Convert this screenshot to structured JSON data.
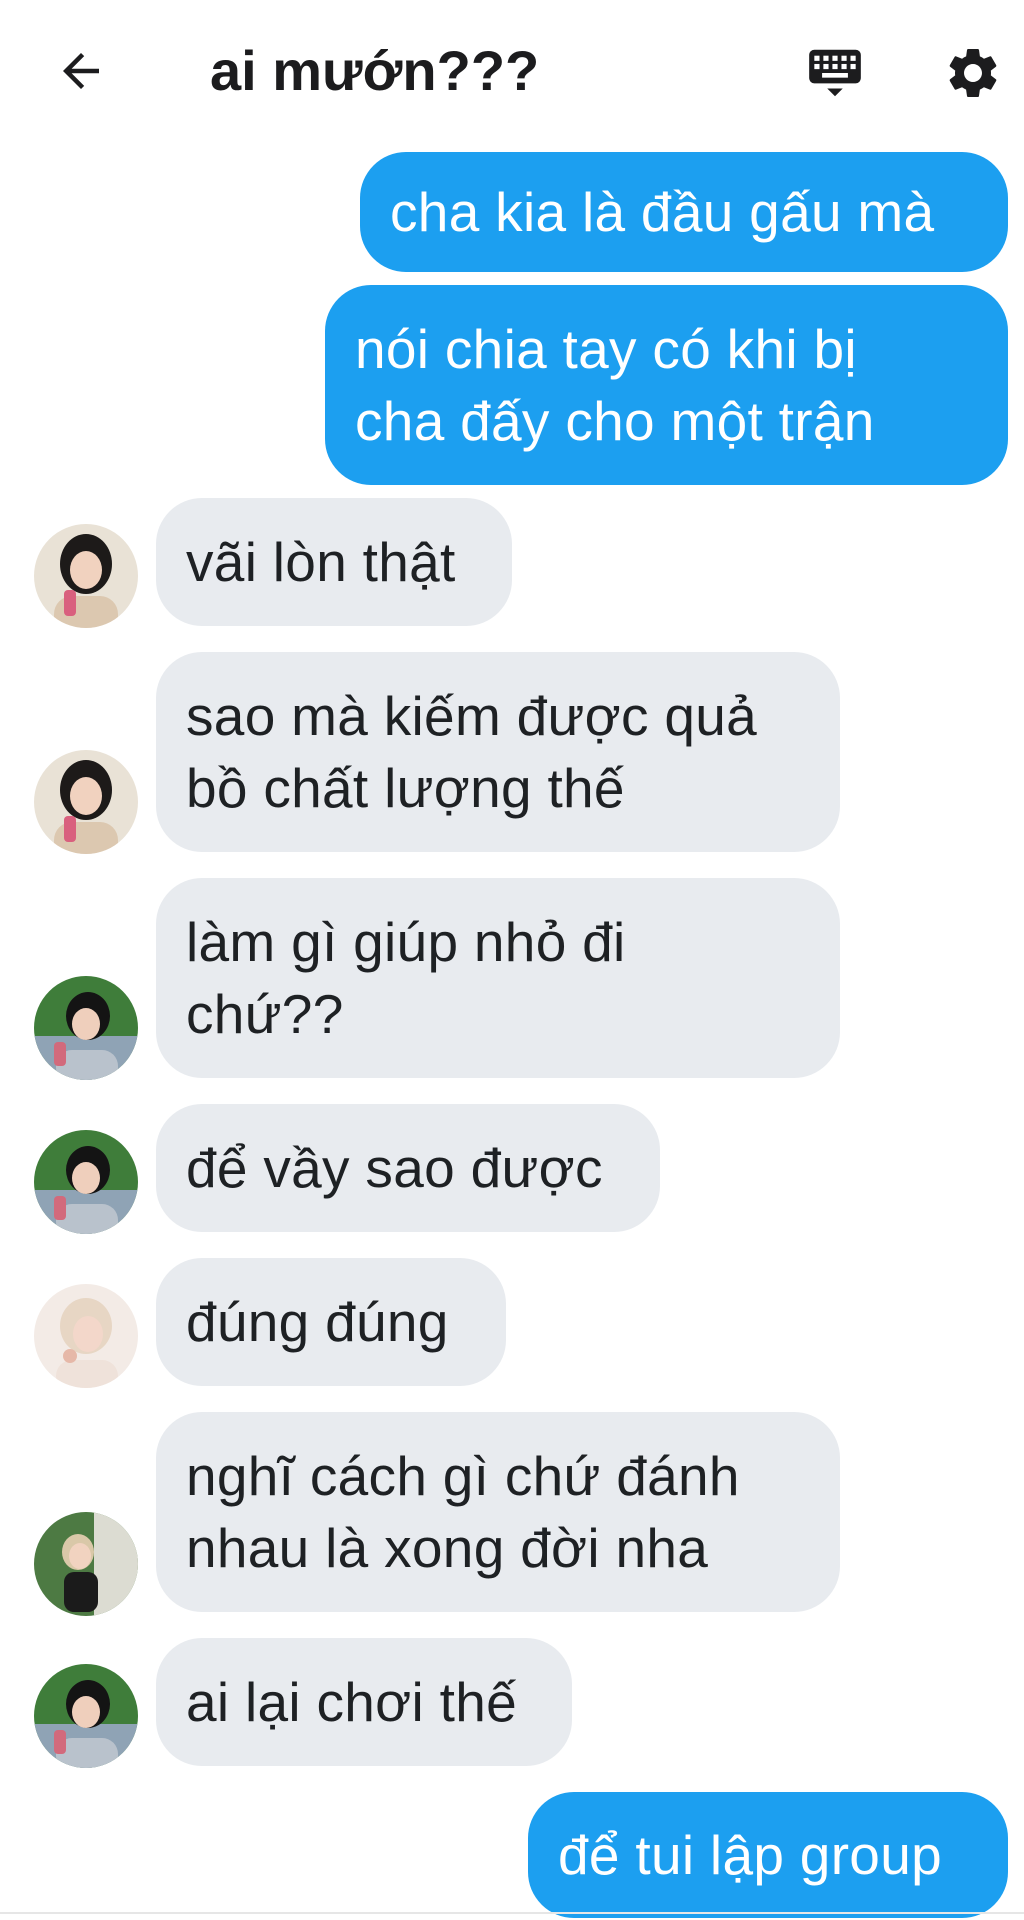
{
  "header": {
    "title": "ai mướn???",
    "back_icon": "arrow-left-icon",
    "keyboard_icon": "keyboard-icon",
    "settings_icon": "gear-icon"
  },
  "colors": {
    "sent_bubble": "#1c9ff0",
    "received_bubble": "#e8ebef"
  },
  "messages": [
    {
      "side": "sent",
      "text": "cha kia là đầu gấu mà"
    },
    {
      "side": "sent",
      "text": "nói chia tay có khi bị\ncha đấy cho một trận"
    },
    {
      "side": "received",
      "sender_avatar": "avatar-girl-dark-hair",
      "text": "vãi lòn thật"
    },
    {
      "side": "received",
      "sender_avatar": "avatar-girl-dark-hair",
      "text": "sao mà kiếm được quả\nbồ chất lượng thế"
    },
    {
      "side": "received",
      "sender_avatar": "avatar-boy-green-background",
      "text": "làm gì giúp nhỏ đi\nchứ??"
    },
    {
      "side": "received",
      "sender_avatar": "avatar-boy-green-background",
      "text": "để vầy sao được"
    },
    {
      "side": "received",
      "sender_avatar": "avatar-light-hair",
      "text": "đúng đúng"
    },
    {
      "side": "received",
      "sender_avatar": "avatar-girl-outdoor",
      "text": "nghĩ cách gì chứ đánh\nnhau là xong đời nha"
    },
    {
      "side": "received",
      "sender_avatar": "avatar-boy-green-background",
      "text": "ai lại chơi thế"
    },
    {
      "side": "sent",
      "text": "để tui lập group"
    }
  ]
}
